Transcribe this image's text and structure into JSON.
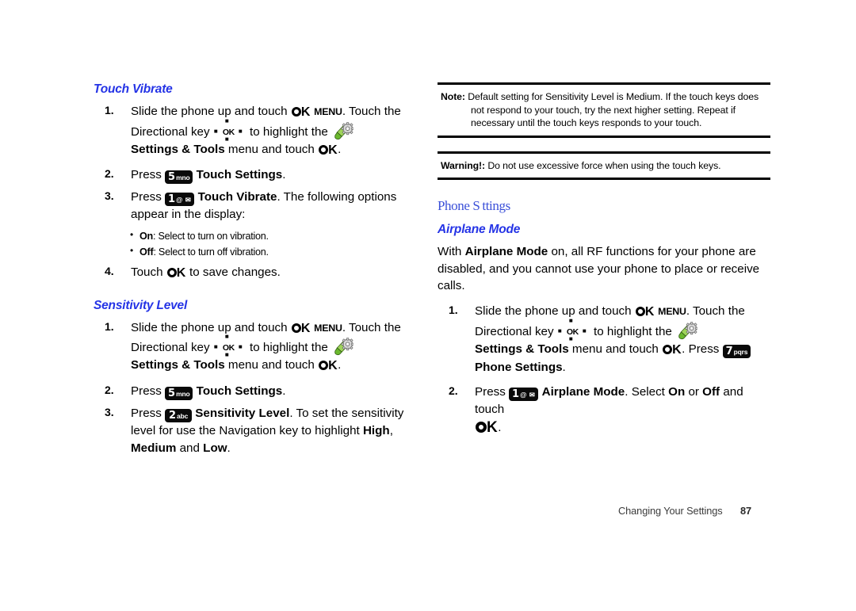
{
  "document": {
    "type": "user-manual-page",
    "footer": {
      "section_label": "Changing Your Settings",
      "page_number": "87"
    },
    "colors": {
      "heading_blue": "#2433e6",
      "main_heading_blue": "#3a4fd8",
      "key_chip_background": "#0a0a0a",
      "body_text": "#000000"
    }
  },
  "left_column": {
    "sections": [
      {
        "heading": "Touch Vibrate",
        "steps": [
          {
            "number": "1.",
            "part1": "Slide the phone up and touch ",
            "ok1": "OK",
            "menu": "MENU",
            "part2": ". Touch the Directional key ",
            "dkey_label": "OK",
            "part3": " to highlight the ",
            "bold_menu": "Settings & Tools",
            "part4": " menu and touch ",
            "ok2": "OK",
            "part5": "."
          },
          {
            "number": "2.",
            "press": "Press ",
            "key_digit": "5",
            "key_letters": "mno",
            "bold_label": "Touch Settings",
            "tail": "."
          },
          {
            "number": "3.",
            "press": "Press ",
            "key_digit": "1",
            "key_letters": "@ ✉",
            "bold_label": "Touch Vibrate",
            "tail": ". The following options appear in the display:"
          }
        ],
        "bullets": [
          {
            "term": "On",
            "text": ": Select to turn on vibration."
          },
          {
            "term": "Off",
            "text": ": Select to turn off vibration."
          }
        ],
        "final_step": {
          "number": "4.",
          "part1": "Touch ",
          "ok": "OK",
          "part2": " to save changes."
        }
      },
      {
        "heading": "Sensitivity Level",
        "steps": [
          {
            "number": "1.",
            "part1": "Slide the phone up and touch ",
            "ok1": "OK",
            "menu": "MENU",
            "part2": ". Touch the Directional key ",
            "dkey_label": "OK",
            "part3": " to highlight the ",
            "bold_menu": "Settings & Tools",
            "part4": " menu and touch ",
            "ok2": "OK",
            "part5": "."
          },
          {
            "number": "2.",
            "press": "Press ",
            "key_digit": "5",
            "key_letters": "mno",
            "bold_label": "Touch Settings",
            "tail": "."
          },
          {
            "number": "3.",
            "press": "Press ",
            "key_digit": "2",
            "key_letters": "abc",
            "bold_label": "Sensitivity Level",
            "tail_a": ". To set the sensitivity level for use the Navigation key to highlight ",
            "opt_high": "High",
            "sep1": ", ",
            "opt_medium": "Medium",
            "sep2": " and ",
            "opt_low": "Low",
            "tail_b": "."
          }
        ]
      }
    ]
  },
  "right_column": {
    "note": {
      "label": "Note:",
      "text": "Default setting for Sensitivity Level is Medium. If the touch keys does not respond to your touch, try the next higher setting. Repeat if necessary until the touch keys responds to your touch."
    },
    "warning": {
      "label": "Warning!:",
      "text": "Do not use excessive force when using the touch keys."
    },
    "main_heading": "Phone Settings",
    "main_heading_render": "Phone S ttings",
    "sub_heading": "Airplane Mode",
    "intro": {
      "part1": "With ",
      "bold": "Airplane Mode",
      "part2": " on, all RF functions for your phone are disabled, and you cannot use your phone to place or receive calls."
    },
    "steps": [
      {
        "number": "1.",
        "part1": "Slide the phone up and touch ",
        "ok1": "OK",
        "menu": "MENU",
        "part2": ". Touch the Directional key ",
        "dkey_label": "OK",
        "part3": " to highlight the ",
        "bold_menu": "Settings & Tools",
        "part4": " menu and touch ",
        "ok2": "OK",
        "part5": ". Press ",
        "key_digit": "7",
        "key_letters": "pqrs",
        "bold_tail": "Phone Settings",
        "period": "."
      },
      {
        "number": "2.",
        "press": "Press ",
        "key_digit": "1",
        "key_letters": "@ ✉",
        "bold_label": "Airplane Mode",
        "mid": ". Select ",
        "opt_on": "On",
        "or": " or ",
        "opt_off": "Off",
        "tail": " and touch ",
        "ok": "OK",
        "end": "."
      }
    ]
  }
}
